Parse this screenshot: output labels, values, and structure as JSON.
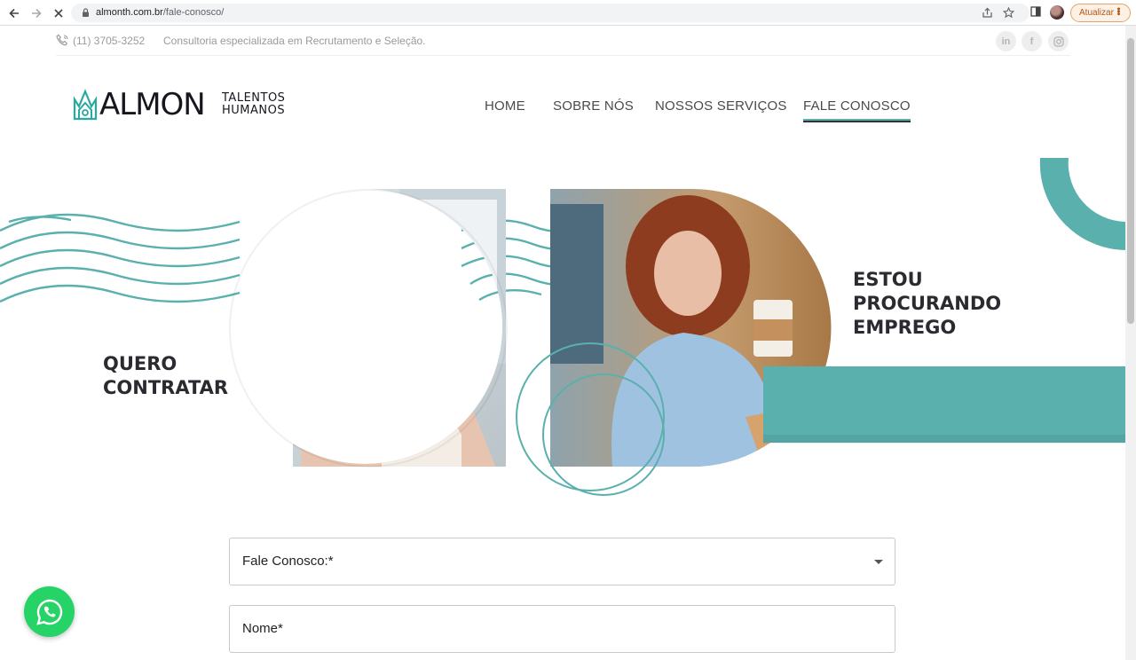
{
  "browser": {
    "url_host": "almonth.com.br",
    "url_path": "/fale-conosco/",
    "update_label": "Atualizar"
  },
  "topbar": {
    "phone": "(11) 3705-3252",
    "tagline": "Consultoria especializada em Recrutamento e Seleção.",
    "social": [
      "in",
      "f",
      "ig"
    ]
  },
  "logo": {
    "main": "ALMON",
    "sub_line1": "TALENTOS",
    "sub_line2": "HUMANOS"
  },
  "menu": {
    "home": "HOME",
    "about": "SOBRE NÓS",
    "services": "NOSSOS SERVIÇOS",
    "contact": "FALE CONOSCO"
  },
  "hero": {
    "left_title_1": "QUERO",
    "left_title_2": "CONTRATAR",
    "right_title_1": "ESTOU",
    "right_title_2": "PROCURANDO",
    "right_title_3": "EMPREGO"
  },
  "form": {
    "subject_label": "Fale Conosco:*",
    "name_label": "Nome*"
  },
  "colors": {
    "teal": "#5ab0ac",
    "update_orange": "#b0561b",
    "whatsapp": "#25d366"
  }
}
